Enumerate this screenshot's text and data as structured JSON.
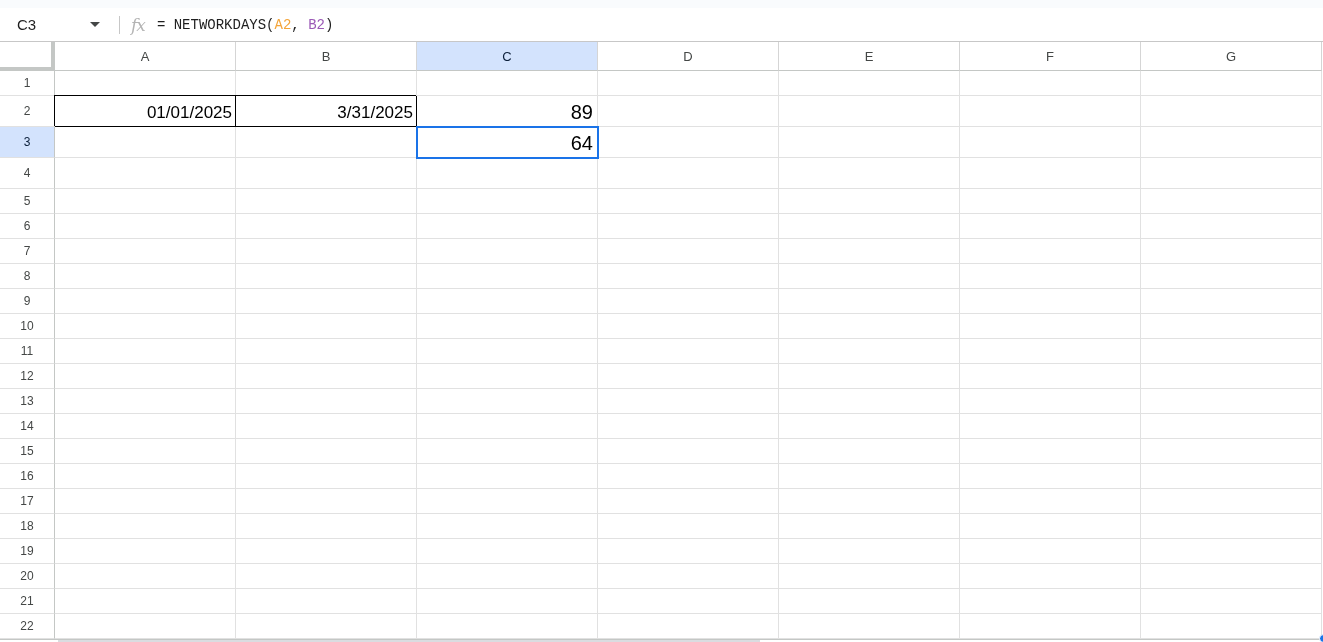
{
  "formula_bar": {
    "cell_reference": "C3",
    "function_label": "fx",
    "formula": [
      {
        "text": "= NETWORKDAYS("
      },
      {
        "text": "A2",
        "color": "#f4a53a"
      },
      {
        "text": ", "
      },
      {
        "text": "B2",
        "color": "#9b59b6"
      },
      {
        "text": ")"
      }
    ]
  },
  "columns": [
    {
      "label": "A",
      "selected": false
    },
    {
      "label": "B",
      "selected": false
    },
    {
      "label": "C",
      "selected": true
    },
    {
      "label": "D",
      "selected": false
    },
    {
      "label": "E",
      "selected": false
    },
    {
      "label": "F",
      "selected": false
    },
    {
      "label": "G",
      "selected": false
    }
  ],
  "rows": [
    {
      "label": "1",
      "selected": false
    },
    {
      "label": "2",
      "selected": false,
      "cells": [
        {
          "value": "01/01/2025",
          "kind": "date",
          "bordered": true,
          "selected": false
        },
        {
          "value": "3/31/2025",
          "kind": "date",
          "bordered": true,
          "selected": false
        },
        {
          "value": "89",
          "kind": "number",
          "bordered": false,
          "selected": false
        }
      ]
    },
    {
      "label": "3",
      "selected": true,
      "cells": [
        {
          "bordered": false,
          "selected": false
        },
        {
          "bordered": false,
          "selected": false
        },
        {
          "value": "64",
          "kind": "number",
          "bordered": false,
          "selected": true
        }
      ]
    },
    {
      "label": "4",
      "selected": false
    },
    {
      "label": "5",
      "selected": false
    },
    {
      "label": "6",
      "selected": false
    },
    {
      "label": "7",
      "selected": false
    },
    {
      "label": "8",
      "selected": false
    },
    {
      "label": "9",
      "selected": false
    },
    {
      "label": "10",
      "selected": false
    },
    {
      "label": "11",
      "selected": false
    },
    {
      "label": "12",
      "selected": false
    },
    {
      "label": "13",
      "selected": false
    },
    {
      "label": "14",
      "selected": false
    },
    {
      "label": "15",
      "selected": false
    },
    {
      "label": "16",
      "selected": false
    },
    {
      "label": "17",
      "selected": false
    },
    {
      "label": "18",
      "selected": false
    },
    {
      "label": "19",
      "selected": false
    },
    {
      "label": "20",
      "selected": false
    },
    {
      "label": "21",
      "selected": false
    },
    {
      "label": "22",
      "selected": false
    }
  ]
}
